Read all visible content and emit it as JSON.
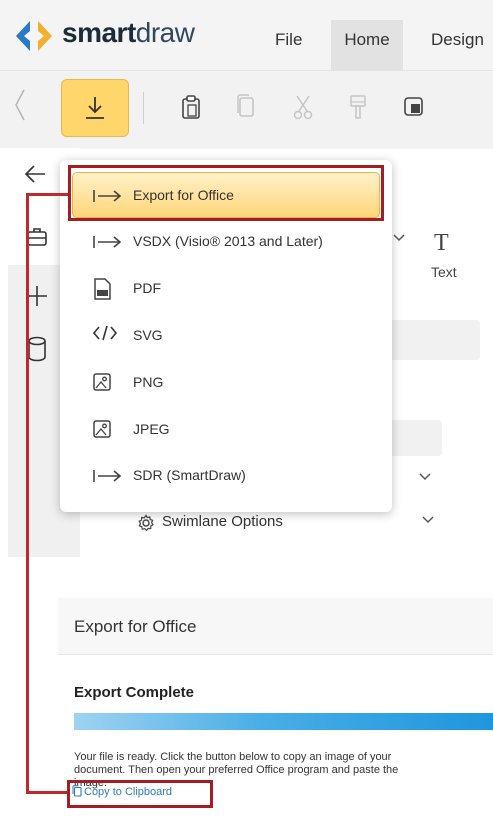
{
  "header": {
    "logo_bold": "smart",
    "logo_light": "draw",
    "menu": [
      "File",
      "Home",
      "Design"
    ]
  },
  "panel": {
    "text_tool_label": "Text",
    "swimlane_label": "Swimlane Options"
  },
  "dropdown": {
    "items": [
      {
        "icon": "export-arrow-icon",
        "label": "Export for Office"
      },
      {
        "icon": "export-arrow-icon",
        "label": "VSDX (Visio® 2013 and Later)"
      },
      {
        "icon": "pdf-file-icon",
        "label": "PDF"
      },
      {
        "icon": "code-icon",
        "label": "SVG"
      },
      {
        "icon": "image-icon",
        "label": "PNG"
      },
      {
        "icon": "image-icon",
        "label": "JPEG"
      },
      {
        "icon": "export-arrow-icon",
        "label": "SDR (SmartDraw)"
      }
    ],
    "selected_index": 0
  },
  "export": {
    "title": "Export for Office",
    "status": "Export Complete",
    "progress": 1.0,
    "message": "Your file is ready. Click the button below to copy an image of your document. Then open your preferred Office program and paste the image.",
    "copy_label": "Copy to Clipboard"
  },
  "colors": {
    "accent_yellow": "#ffd66b",
    "annotation_red": "#a51c22",
    "progress_blue": "#1f96dd",
    "link_blue": "#2f79c4"
  }
}
